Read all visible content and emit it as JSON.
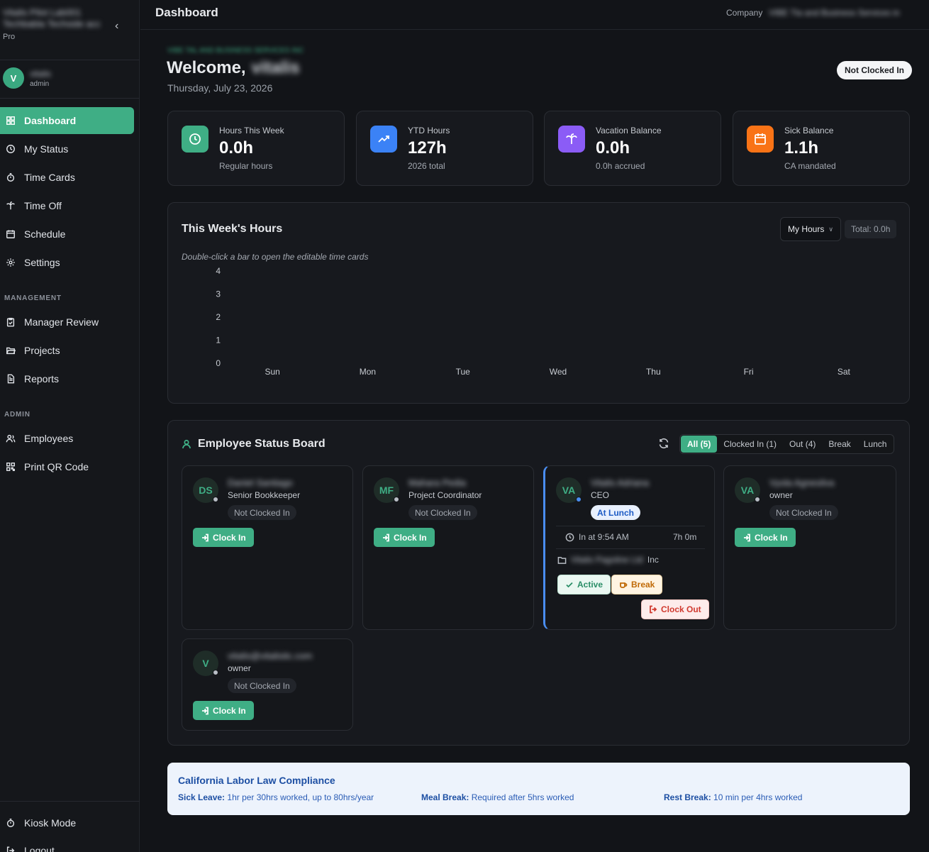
{
  "sidebar": {
    "brand_line1": "Vitalis Pilot Lab001",
    "brand_line2": "Techbabla Techside acc",
    "plan": "Pro",
    "user_initial": "V",
    "user_name": "vitalis",
    "user_role": "admin",
    "items": [
      {
        "label": "Dashboard",
        "icon": "grid-icon",
        "active": true
      },
      {
        "label": "My Status",
        "icon": "clock-icon"
      },
      {
        "label": "Time Cards",
        "icon": "stopwatch-icon"
      },
      {
        "label": "Time Off",
        "icon": "palm-tree-icon"
      },
      {
        "label": "Schedule",
        "icon": "calendar-icon"
      },
      {
        "label": "Settings",
        "icon": "gear-icon"
      }
    ],
    "management_label": "MANAGEMENT",
    "management_items": [
      {
        "label": "Manager Review",
        "icon": "clipboard-check-icon"
      },
      {
        "label": "Projects",
        "icon": "folder-open-icon"
      },
      {
        "label": "Reports",
        "icon": "file-text-icon"
      }
    ],
    "admin_label": "ADMIN",
    "admin_items": [
      {
        "label": "Employees",
        "icon": "users-icon"
      },
      {
        "label": "Print QR Code",
        "icon": "qr-code-icon"
      }
    ],
    "bottom_items": [
      {
        "label": "Kiosk Mode",
        "icon": "timer-icon"
      },
      {
        "label": "Logout",
        "icon": "logout-icon"
      }
    ]
  },
  "header": {
    "title": "Dashboard",
    "company_label": "Company",
    "company_value": "VIBE Tla and Business Services in"
  },
  "welcome": {
    "company_tag": "VIBE TAL AND BUSINESS SERVICES INC",
    "greeting": "Welcome,",
    "name": "vitalis",
    "date": "Thursday, July 23, 2026",
    "status_pill": "Not Clocked In"
  },
  "stats": [
    {
      "label": "Hours This Week",
      "value": "0.0h",
      "sub": "Regular hours",
      "icon": "clock-icon",
      "color": "#3fae85"
    },
    {
      "label": "YTD Hours",
      "value": "127h",
      "sub": "2026 total",
      "icon": "trending-up-icon",
      "color": "#3b82f6"
    },
    {
      "label": "Vacation Balance",
      "value": "0.0h",
      "sub": "0.0h accrued",
      "icon": "palm-tree-icon",
      "color": "#8b5cf6"
    },
    {
      "label": "Sick Balance",
      "value": "1.1h",
      "sub": "CA mandated",
      "icon": "calendar-icon",
      "color": "#f97316"
    }
  ],
  "week": {
    "title": "This Week's Hours",
    "selector": "My Hours",
    "total": "Total: 0.0h",
    "hint": "Double-click a bar to open the editable time cards"
  },
  "chart_data": {
    "type": "bar",
    "categories": [
      "Sun",
      "Mon",
      "Tue",
      "Wed",
      "Thu",
      "Fri",
      "Sat"
    ],
    "values": [
      0,
      0,
      0,
      0,
      0,
      0,
      0
    ],
    "yticks": [
      0,
      1,
      2,
      3,
      4
    ],
    "ylim": [
      0,
      4
    ],
    "grid": false,
    "title": "",
    "xlabel": "",
    "ylabel": ""
  },
  "board": {
    "title": "Employee Status Board",
    "filters": [
      "All (5)",
      "Clocked In (1)",
      "Out (4)",
      "Break",
      "Lunch"
    ],
    "clock_in_label": "Clock In",
    "employees": [
      {
        "initials": "DS",
        "name": "Daniel Santiago",
        "role": "Senior Bookkeeper",
        "status": "Not Clocked In"
      },
      {
        "initials": "MF",
        "name": "Mahara Pedia",
        "role": "Project Coordinator",
        "status": "Not Clocked In"
      },
      {
        "initials": "VA",
        "name": "Vitalis Adriana",
        "role": "CEO",
        "status": "At Lunch",
        "in_at": "In at 9:54 AM",
        "duration": "7h 0m",
        "project_blur": "Vitalis Pagoline Ltd",
        "project_suffix": "Inc",
        "active_label": "Active",
        "break_label": "Break",
        "clock_out_label": "Clock Out"
      },
      {
        "initials": "VA",
        "name": "Vyola Agnesilva",
        "role": "owner",
        "status": "Not Clocked In"
      },
      {
        "initials": "V",
        "name": "vitalis@vitalisitc.com",
        "role": "owner",
        "status": "Not Clocked In"
      }
    ]
  },
  "compliance": {
    "title": "California Labor Law Compliance",
    "items": [
      {
        "label": "Sick Leave:",
        "text": "1hr per 30hrs worked, up to 80hrs/year"
      },
      {
        "label": "Meal Break:",
        "text": "Required after 5hrs worked"
      },
      {
        "label": "Rest Break:",
        "text": "10 min per 4hrs worked"
      }
    ]
  }
}
